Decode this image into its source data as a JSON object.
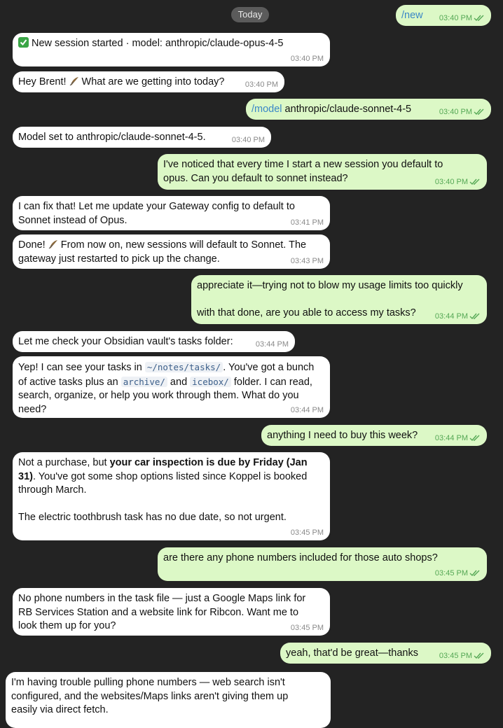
{
  "date_divider": "Today",
  "messages": {
    "m1": {
      "text": "/new",
      "time": "03:40 PM"
    },
    "m2": {
      "text": "New session started · model: anthropic/claude-opus-4-5",
      "time": "03:40 PM",
      "icon": "check-mark-button-icon"
    },
    "m3": {
      "text_a": "Hey Brent! ",
      "text_b": " What are we getting into today?",
      "time": "03:40 PM",
      "icon": "feather-icon"
    },
    "m4": {
      "cmd": "/model",
      "text": " anthropic/claude-sonnet-4-5",
      "time": "03:40 PM"
    },
    "m5": {
      "text": "Model set to anthropic/claude-sonnet-4-5.",
      "time": "03:40 PM"
    },
    "m6": {
      "l1": "I've noticed that every time I start a new session you default to",
      "l2": "opus. Can you default to sonnet instead?",
      "time": "03:40 PM"
    },
    "m7": {
      "l1": "I can fix that! Let me update your Gateway config to default to",
      "l2": "Sonnet instead of Opus.",
      "time": "03:41 PM"
    },
    "m8": {
      "l1a": "Done! ",
      "l1b": " From now on, new sessions will default to Sonnet. The",
      "l2": "gateway just restarted to pick up the change.",
      "time": "03:43 PM",
      "icon": "feather-icon"
    },
    "m9": {
      "l1": "appreciate it—trying not to blow my usage limits too quickly",
      "l2": "with that done, are you able to access my tasks?",
      "time": "03:44 PM"
    },
    "m10": {
      "text": "Let me check your Obsidian vault's tasks folder:",
      "time": "03:44 PM"
    },
    "m11": {
      "l1a": "Yep! I can see your tasks in ",
      "code1": "~/notes/tasks/",
      "l1b": ". You've got a bunch",
      "l2a": "of active tasks plus an ",
      "code2": "archive/",
      "l2b": " and ",
      "code3": "icebox/",
      "l2c": " folder. I can read,",
      "l3": "search, organize, or help you work through them. What do you",
      "l4": "need?",
      "time": "03:44 PM"
    },
    "m12": {
      "text": "anything I need to buy this week?",
      "time": "03:44 PM"
    },
    "m13": {
      "l1a": "Not a purchase, but ",
      "l1b": "your car inspection is due by Friday (Jan",
      "l2a": "31)",
      "l2b": ". You've got some shop options listed since Koppel is booked",
      "l3": "through March.",
      "l4": "The electric toothbrush task has no due date, so not urgent.",
      "time": "03:45 PM"
    },
    "m14": {
      "text": "are there any phone numbers included for those auto shops?",
      "time": "03:45 PM"
    },
    "m15": {
      "l1": "No phone numbers in the task file — just a Google Maps link for",
      "l2": "RB Services Station and a website link for Ribcon. Want me to",
      "l3": "look them up for you?",
      "time": "03:45 PM"
    },
    "m16": {
      "text": "yeah, that'd be great—thanks",
      "time": "03:45 PM"
    },
    "m17": {
      "l1": "I'm having trouble pulling phone numbers — web search isn't",
      "l2": "configured, and the websites/Maps links aren't giving them up",
      "l3": "easily via direct fetch."
    }
  },
  "colors": {
    "background": "#232323",
    "incoming_bubble": "#ffffff",
    "outgoing_bubble": "#dcf8c6",
    "link": "#3a87c7",
    "read_check": "#55a855"
  }
}
